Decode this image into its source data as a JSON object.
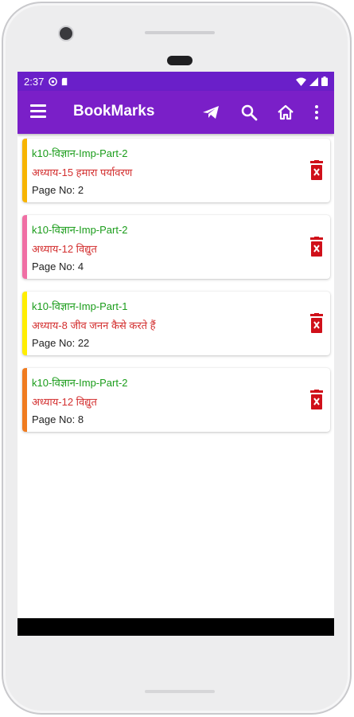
{
  "status_bar": {
    "time": "2:37",
    "icons": [
      "settings-circle-icon",
      "sd-card-icon",
      "wifi-icon",
      "signal-icon",
      "battery-icon"
    ]
  },
  "toolbar": {
    "title": "BookMarks",
    "icons": [
      "menu-icon",
      "send-icon",
      "search-icon",
      "home-icon",
      "more-vert-icon"
    ]
  },
  "bookmarks": [
    {
      "book": "k10-विज्ञान-Imp-Part-2",
      "chapter": "अध्याय-15 हमारा पर्यावरण",
      "page": "Page No: 2",
      "color": "#f7b400"
    },
    {
      "book": "k10-विज्ञान-Imp-Part-2",
      "chapter": "अध्याय-12 विद्युत",
      "page": "Page No: 4",
      "color": "#f06fa4"
    },
    {
      "book": "k10-विज्ञान-Imp-Part-1",
      "chapter": "अध्याय-8 जीव जनन कैसे करते हैं",
      "page": "Page No: 22",
      "color": "#ffee00"
    },
    {
      "book": "k10-विज्ञान-Imp-Part-2",
      "chapter": "अध्याय-12 विद्युत",
      "page": "Page No: 8",
      "color": "#f07b1f"
    }
  ],
  "colors": {
    "status_bar": "#6a1fc9",
    "toolbar": "#7a1fc8",
    "book_text": "#1a9c1a",
    "chapter_text": "#d32f2f",
    "delete_icon": "#d0101a"
  }
}
